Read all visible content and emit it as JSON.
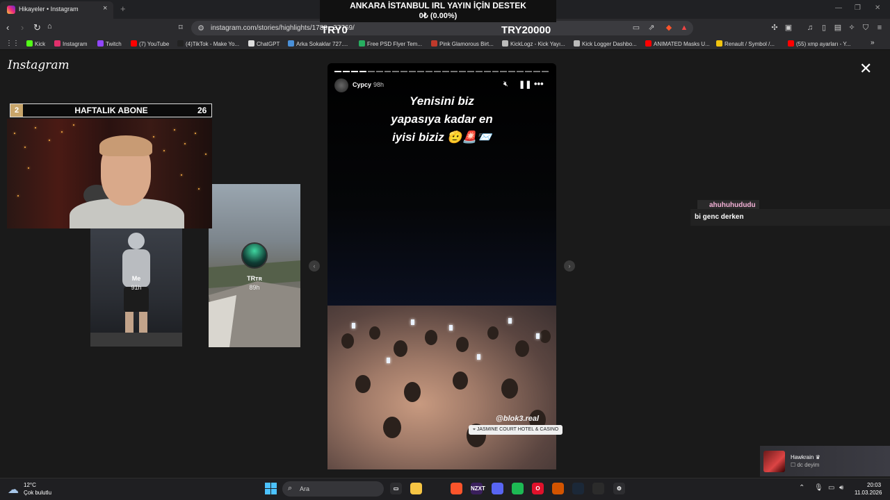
{
  "browser": {
    "tab_title": "Hikayeler • Instagram",
    "tab_close": "×",
    "new_tab": "+",
    "url": "instagram.com/stories/highlights/1788...37769/",
    "bookmarks": [
      {
        "label": "Kick",
        "color": "#53fc18"
      },
      {
        "label": "Instagram",
        "color": "#e1306c"
      },
      {
        "label": "Twitch",
        "color": "#9146ff"
      },
      {
        "label": "(7) YouTube",
        "color": "#ff0000"
      },
      {
        "label": "(4)TikTok - Make Yo...",
        "color": "#222222"
      },
      {
        "label": "ChatGPT",
        "color": "#dddddd"
      },
      {
        "label": "Arka Sokaklar 727....",
        "color": "#4a90d9"
      },
      {
        "label": "Free PSD Flyer Tem...",
        "color": "#27ae60"
      },
      {
        "label": "Pink Glamorous Birt...",
        "color": "#c0392b"
      },
      {
        "label": "KickLogz - Kick Yayı...",
        "color": "#bbbbbb"
      },
      {
        "label": "Kick Logger Dashbo...",
        "color": "#bbbbbb"
      },
      {
        "label": "ANIMATED Masks U...",
        "color": "#ff0000"
      },
      {
        "label": "Renault / Symbol /...",
        "color": "#f1c40f"
      },
      {
        "label": "(55) xmp ayarları - Y...",
        "color": "#ff0000"
      }
    ],
    "bookmarks_more": "»"
  },
  "stream_overlay": {
    "donation_title": "ANKARA İSTANBUL IRL YAYIN İÇİN DESTEK",
    "donation_progress": "0₺ (0.00%)",
    "donation_min": "TRY0",
    "donation_max": "TRY20000",
    "sub_rank": "2",
    "sub_label": "HAFTALIK ABONE",
    "sub_count": "26"
  },
  "instagram": {
    "logo": "Instagram",
    "close": "✕",
    "cards": [
      {
        "name": "Me",
        "time": "91h"
      },
      {
        "name": "TRᴛʀ",
        "time": "89h"
      }
    ],
    "story": {
      "user": "Cypcy",
      "time": "98h",
      "caption_lines": [
        "Yenisini biz",
        "yapasıya kadar en",
        "iyisi biziz 🫡🚨📨"
      ],
      "watermark": "@blok3.real",
      "location": "JASMINE COURT HOTEL & CASINO",
      "progress_total": 26,
      "progress_done": 4
    },
    "prev_arrow": "‹",
    "next_arrow": "›"
  },
  "chat": {
    "user": "ahuhuhududu",
    "message": "bi genc derken"
  },
  "notification": {
    "name": "Hawkrain ♛",
    "message": "dc deyim"
  },
  "taskbar": {
    "weather_temp": "12°C",
    "weather_desc": "Çok bulutlu",
    "search_placeholder": "Ara",
    "time": "20:03",
    "date": "11.03.2026",
    "apps": [
      {
        "name": "task-view",
        "label": "▭",
        "color": "#2d2d30"
      },
      {
        "name": "file-explorer",
        "label": "",
        "color": "#f6c544"
      },
      {
        "name": "brave",
        "label": "",
        "color": "#fb542b"
      },
      {
        "name": "nzxt",
        "label": "NZXT",
        "color": "#3a1f5c"
      },
      {
        "name": "discord",
        "label": "",
        "color": "#5865f2"
      },
      {
        "name": "spotify",
        "label": "",
        "color": "#1db954"
      },
      {
        "name": "opera",
        "label": "O",
        "color": "#e0112b"
      },
      {
        "name": "game-app",
        "label": "",
        "color": "#d35400"
      },
      {
        "name": "steam",
        "label": "",
        "color": "#1b2838"
      },
      {
        "name": "obs",
        "label": "",
        "color": "#2b2b2b"
      },
      {
        "name": "settings",
        "label": "⚙",
        "color": "#2d2d30"
      }
    ]
  }
}
